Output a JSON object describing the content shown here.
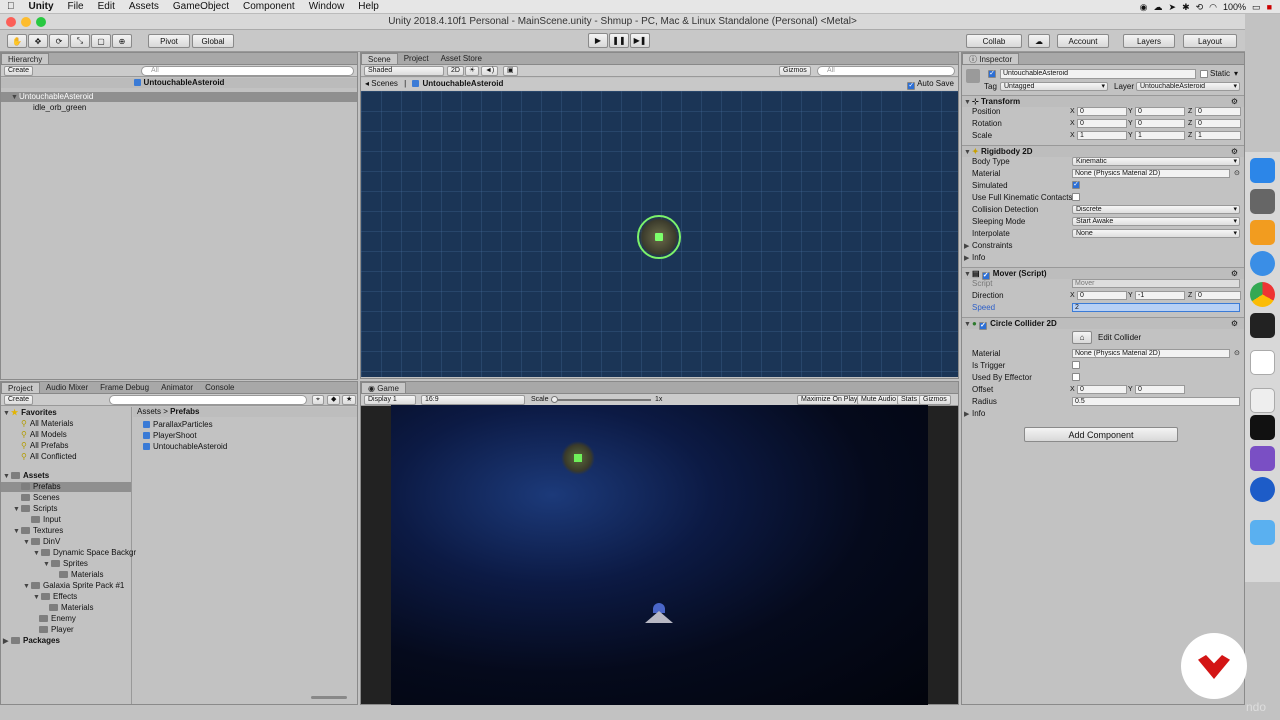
{
  "menubar": {
    "apple": "",
    "app": "Unity",
    "items": [
      "File",
      "Edit",
      "Assets",
      "GameObject",
      "Component",
      "Window",
      "Help"
    ],
    "battery": "100%"
  },
  "window": {
    "title": "Unity 2018.4.10f1 Personal - MainScene.unity - Shmup - PC, Mac & Linux Standalone (Personal) <Metal>"
  },
  "toolbar": {
    "pivot": "Pivot",
    "global": "Global",
    "collab": "Collab",
    "account": "Account",
    "layers": "Layers",
    "layout": "Layout",
    "play": "▶",
    "pause": "❚❚",
    "step": "▶❚"
  },
  "hierarchy": {
    "tab": "Hierarchy",
    "create": "Create",
    "search": "All",
    "scene": "UntouchableAsteroid",
    "items": [
      "UntouchableAsteroid",
      "idle_orb_green"
    ]
  },
  "scene": {
    "tabs": [
      "Scene",
      "Project",
      "Asset Store"
    ],
    "shaded": "Shaded",
    "mode2d": "2D",
    "gizmos": "Gizmos",
    "search": "All",
    "breadcrumb_root": "Scenes",
    "breadcrumb_item": "UntouchableAsteroid",
    "autosave": "Auto Save"
  },
  "game": {
    "tab": "Game",
    "display": "Display 1",
    "aspect": "16:9",
    "scale_label": "Scale",
    "scale_value": "1x",
    "maximize": "Maximize On Play",
    "mute": "Mute Audio",
    "stats": "Stats",
    "gizmos": "Gizmos"
  },
  "project": {
    "tabs": [
      "Project",
      "Audio Mixer",
      "Frame Debug",
      "Animator",
      "Console"
    ],
    "create": "Create",
    "favorites": "Favorites",
    "fav_items": [
      "All Materials",
      "All Models",
      "All Prefabs",
      "All Conflicted"
    ],
    "assets": "Assets",
    "tree": [
      "Prefabs",
      "Scenes",
      "Scripts",
      "Input",
      "Textures",
      "DinV",
      "Dynamic Space Backgr",
      "Sprites",
      "Materials",
      "Galaxia Sprite Pack #1",
      "Effects",
      "Materials",
      "Enemy",
      "Player"
    ],
    "packages": "Packages",
    "breadcrumb": [
      "Assets",
      "Prefabs"
    ],
    "files": [
      "ParallaxParticles",
      "PlayerShoot",
      "UntouchableAsteroid"
    ]
  },
  "inspector": {
    "tab": "Inspector",
    "name": "UntouchableAsteroid",
    "static": "Static",
    "tag_label": "Tag",
    "tag": "Untagged",
    "layer_label": "Layer",
    "layer": "UntouchableAsteroid",
    "transform": {
      "title": "Transform",
      "position": "Position",
      "rotation": "Rotation",
      "scale": "Scale",
      "pos": [
        "0",
        "0",
        "0"
      ],
      "rot": [
        "0",
        "0",
        "0"
      ],
      "scl": [
        "1",
        "1",
        "1"
      ]
    },
    "rigidbody": {
      "title": "Rigidbody 2D",
      "body_type_label": "Body Type",
      "body_type": "Kinematic",
      "material_label": "Material",
      "material": "None (Physics Material 2D)",
      "simulated": "Simulated",
      "full_kin": "Use Full Kinematic Contacts",
      "collision_label": "Collision Detection",
      "collision": "Discrete",
      "sleeping_label": "Sleeping Mode",
      "sleeping": "Start Awake",
      "interp_label": "Interpolate",
      "interp": "None",
      "constraints": "Constraints",
      "info": "Info"
    },
    "mover": {
      "title": "Mover (Script)",
      "script_label": "Script",
      "script": "Mover",
      "direction_label": "Direction",
      "dir": [
        "0",
        "-1",
        "0"
      ],
      "speed_label": "Speed",
      "speed": "2"
    },
    "collider": {
      "title": "Circle Collider 2D",
      "edit": "Edit Collider",
      "material_label": "Material",
      "material": "None (Physics Material 2D)",
      "trigger": "Is Trigger",
      "effector": "Used By Effector",
      "offset_label": "Offset",
      "offset": [
        "0",
        "0"
      ],
      "radius_label": "Radius",
      "radius": "0.5",
      "info": "Info"
    },
    "add_component": "Add Component"
  },
  "axes": {
    "x": "X",
    "y": "Y",
    "z": "Z"
  },
  "watermark": "ndo"
}
